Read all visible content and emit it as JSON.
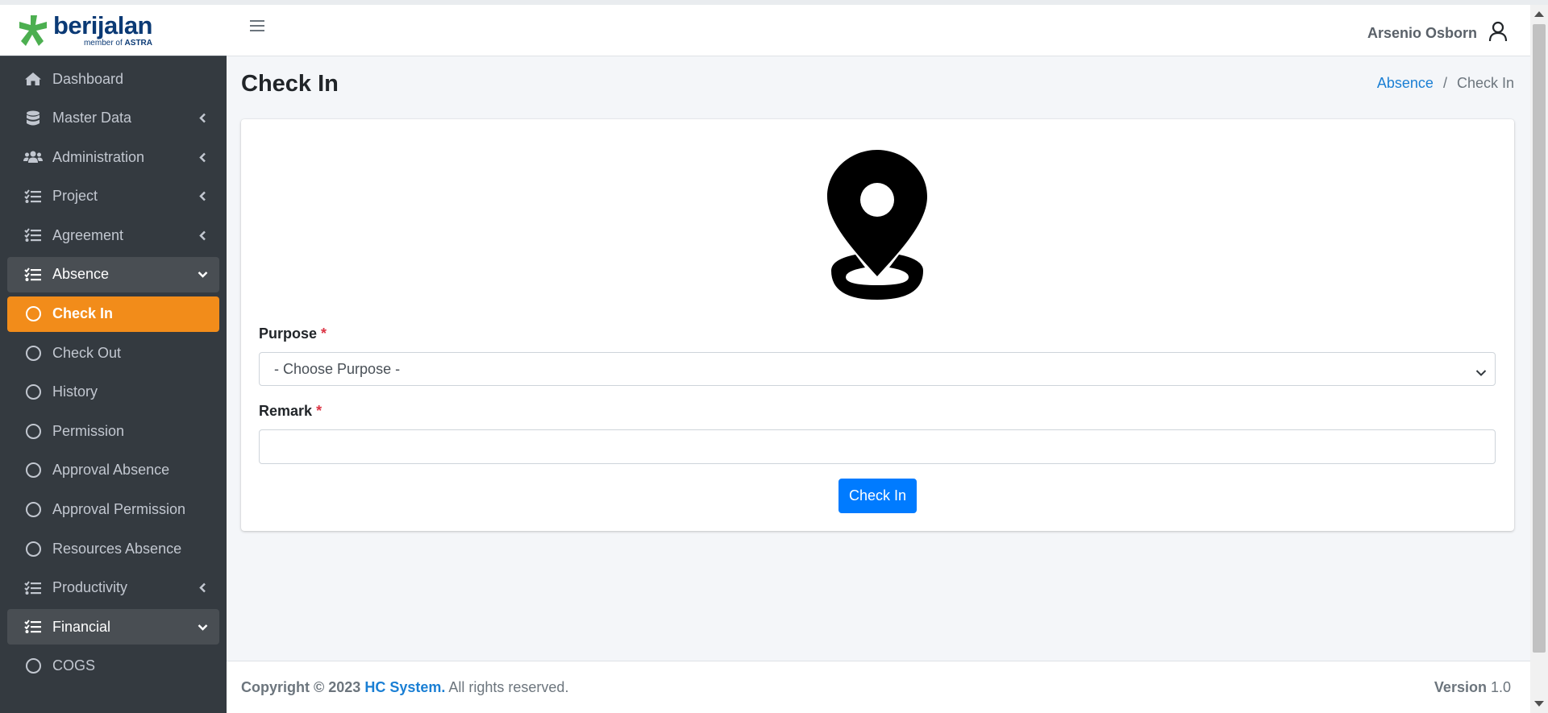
{
  "brand": {
    "name": "berijalan",
    "sub_prefix": "member of ",
    "sub_brand": "ASTRA",
    "logo_color": "#4caf50"
  },
  "sidebar": {
    "items": [
      {
        "label": "Dashboard",
        "icon": "home-icon"
      },
      {
        "label": "Master Data",
        "icon": "database-icon",
        "arrow": "chevron-left-icon"
      },
      {
        "label": "Administration",
        "icon": "users-icon",
        "arrow": "chevron-left-icon"
      },
      {
        "label": "Project",
        "icon": "tasks-icon",
        "arrow": "chevron-left-icon"
      },
      {
        "label": "Agreement",
        "icon": "tasks-icon",
        "arrow": "chevron-left-icon"
      },
      {
        "label": "Absence",
        "icon": "tasks-icon",
        "arrow": "chevron-down-icon",
        "state": "open"
      },
      {
        "label": "Check In",
        "icon": "circle-icon",
        "state": "active"
      },
      {
        "label": "Check Out",
        "icon": "circle-icon"
      },
      {
        "label": "History",
        "icon": "circle-icon"
      },
      {
        "label": "Permission",
        "icon": "circle-icon"
      },
      {
        "label": "Approval Absence",
        "icon": "circle-icon"
      },
      {
        "label": "Approval Permission",
        "icon": "circle-icon"
      },
      {
        "label": "Resources Absence",
        "icon": "circle-icon"
      },
      {
        "label": "Productivity",
        "icon": "tasks-icon",
        "arrow": "chevron-left-icon"
      },
      {
        "label": "Financial",
        "icon": "tasks-icon",
        "arrow": "chevron-down-icon",
        "state": "open"
      },
      {
        "label": "COGS",
        "icon": "circle-icon"
      }
    ]
  },
  "header": {
    "user_name": "Arsenio Osborn"
  },
  "page": {
    "title": "Check In",
    "breadcrumb": {
      "parent": "Absence",
      "separator": "/",
      "current": "Check In"
    }
  },
  "form": {
    "purpose_label": "Purpose",
    "required_mark": "*",
    "purpose_selected": "- Choose Purpose -",
    "remark_label": "Remark",
    "remark_value": "",
    "submit_label": "Check In"
  },
  "footer": {
    "copyright_prefix": "Copyright © 2023",
    "company": "HC System.",
    "rights": "All rights reserved.",
    "version_label": "Version",
    "version_value": "1.0"
  },
  "colors": {
    "sidebar_bg": "#343a40",
    "active_item": "#f28c1a",
    "primary": "#007bff",
    "link": "#1a7fd4",
    "required": "#dc3545"
  }
}
